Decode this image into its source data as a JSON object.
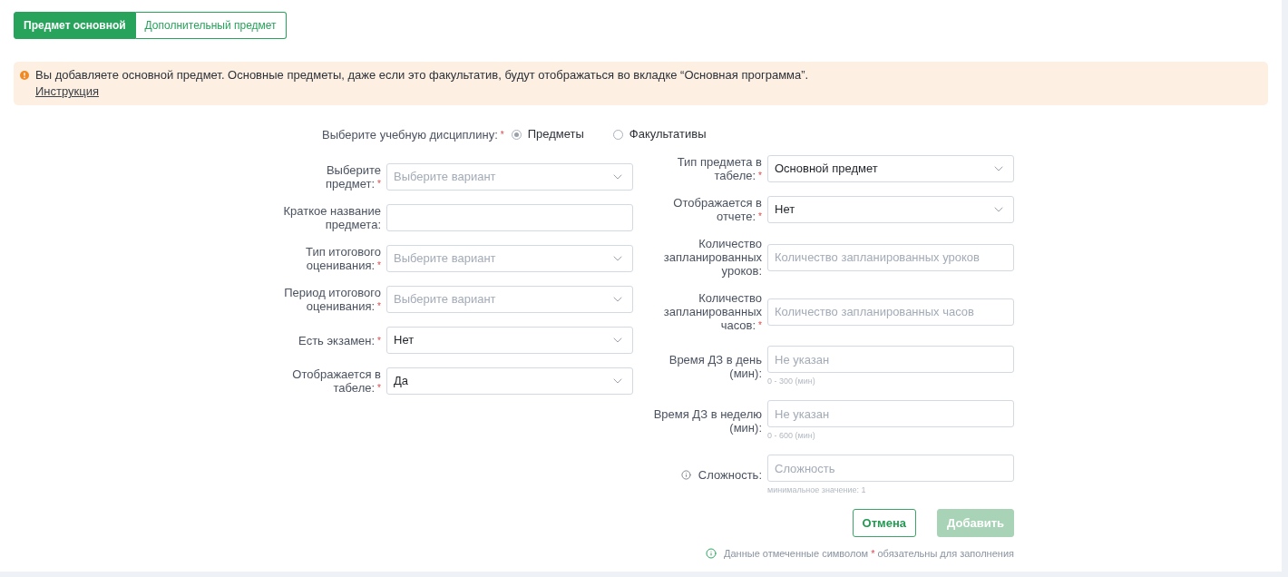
{
  "tabs": [
    {
      "label": "Предмет основной",
      "selected": true
    },
    {
      "label": "Дополнительный предмет",
      "selected": false
    }
  ],
  "alert": {
    "text": "Вы добавляете основной предмет. Основные предметы, даже если это факультатив, будут отображаться во вкладке “Основная программа”.",
    "link": "Инструкция"
  },
  "discipline": {
    "label": "Выберите учебную дисциплину:",
    "required_mark": "*",
    "options": [
      {
        "label": "Предметы",
        "selected": true
      },
      {
        "label": "Факультативы",
        "selected": false
      }
    ]
  },
  "left_fields": [
    {
      "kind": "select",
      "label": "Выберите предмет:",
      "required_mark": "*",
      "placeholder": "Выберите вариант"
    },
    {
      "kind": "text",
      "label": "Краткое название предмета:"
    },
    {
      "kind": "select",
      "label": "Тип итогового оценивания:",
      "required_mark": "*",
      "placeholder": "Выберите вариант"
    },
    {
      "kind": "select",
      "label": "Период итогового оценивания:",
      "required_mark": "*",
      "placeholder": "Выберите вариант"
    },
    {
      "kind": "select",
      "label": "Есть экзамен:",
      "required_mark": "*",
      "value": "Нет"
    },
    {
      "kind": "select",
      "label": "Отображается в табеле:",
      "required_mark": "*",
      "value": "Да"
    }
  ],
  "right_fields": [
    {
      "kind": "select",
      "label": "Тип предмета в табеле:",
      "required_mark": "*",
      "value": "Основной предмет"
    },
    {
      "kind": "select",
      "label": "Отображается в отчете:",
      "required_mark": "*",
      "value": "Нет"
    },
    {
      "kind": "text",
      "label": "Количество запланированных уроков:",
      "placeholder": "Количество запланированных уроков"
    },
    {
      "kind": "text",
      "label": "Количество запланированных часов:",
      "required_mark": "*",
      "placeholder": "Количество запланированных часов"
    },
    {
      "kind": "text",
      "label": "Время ДЗ в день (мин):",
      "placeholder": "Не указан",
      "hint": "0 - 300 (мин)"
    },
    {
      "kind": "text",
      "label": "Время ДЗ в неделю (мин):",
      "placeholder": "Не указан",
      "hint": "0 - 600 (мин)"
    },
    {
      "kind": "text",
      "label": "Сложность:",
      "info": true,
      "placeholder": "Сложность",
      "hint": "минимальное значение: 1"
    }
  ],
  "buttons": [
    {
      "label": "Отмена",
      "kind": "outline",
      "disabled": false
    },
    {
      "label": "Добавить",
      "kind": "primary",
      "disabled": true
    }
  ],
  "footer_note": {
    "before": "Данные отмеченные символом",
    "mark": "*",
    "after": "обязательны для заполнения"
  }
}
